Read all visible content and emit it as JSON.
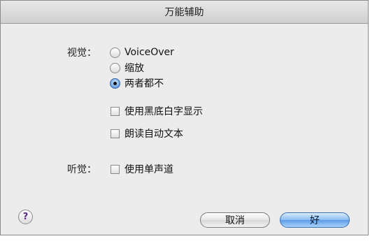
{
  "dialog": {
    "title": "万能辅助",
    "vision": {
      "label": "视觉：",
      "options": [
        {
          "label": "VoiceOver",
          "selected": false
        },
        {
          "label": "缩放",
          "selected": false
        },
        {
          "label": "两者都不",
          "selected": true
        }
      ],
      "checkboxes": [
        {
          "label": "使用黑底白字显示",
          "checked": false
        },
        {
          "label": "朗读自动文本",
          "checked": false
        }
      ]
    },
    "hearing": {
      "label": "听觉：",
      "checkboxes": [
        {
          "label": "使用单声道",
          "checked": false
        }
      ]
    },
    "help_glyph": "?",
    "buttons": {
      "cancel_label": "取消",
      "ok_label": "好"
    }
  },
  "colors": {
    "default_button": "#5e9be2",
    "help_glyph": "#5a2a86",
    "window_bg": "#ececec"
  },
  "icons": {
    "help": "question-mark-circle"
  }
}
